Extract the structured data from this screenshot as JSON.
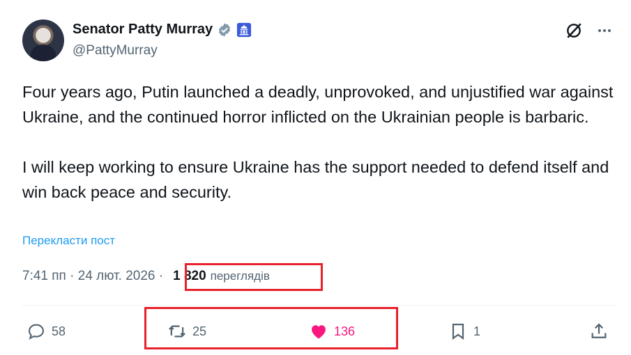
{
  "author": {
    "name": "Senator Patty Murray",
    "handle": "@PattyMurray"
  },
  "post": {
    "text": "Four years ago, Putin launched a deadly, unprovoked, and unjustified war against Ukraine, and the continued horror inflicted on the Ukrainian people is barbaric.\n\nI will keep working to ensure Ukraine has the support needed to defend itself and win back peace and security.",
    "translate_label": "Перекласти пост",
    "timestamp": "7:41 пп · 24 лют. 2026 ·",
    "views_count": "1 820",
    "views_label": "переглядів"
  },
  "actions": {
    "replies": "58",
    "reposts": "25",
    "likes": "136",
    "bookmarks": "1"
  },
  "colors": {
    "accent": "#1d9bf0",
    "like": "#f91880",
    "highlight": "#e8202a",
    "muted": "#536471"
  },
  "icons": [
    "verified-badge-icon",
    "government-badge-icon",
    "grok-icon",
    "more-icon",
    "reply-icon",
    "repost-icon",
    "like-icon",
    "bookmark-icon",
    "share-icon"
  ]
}
